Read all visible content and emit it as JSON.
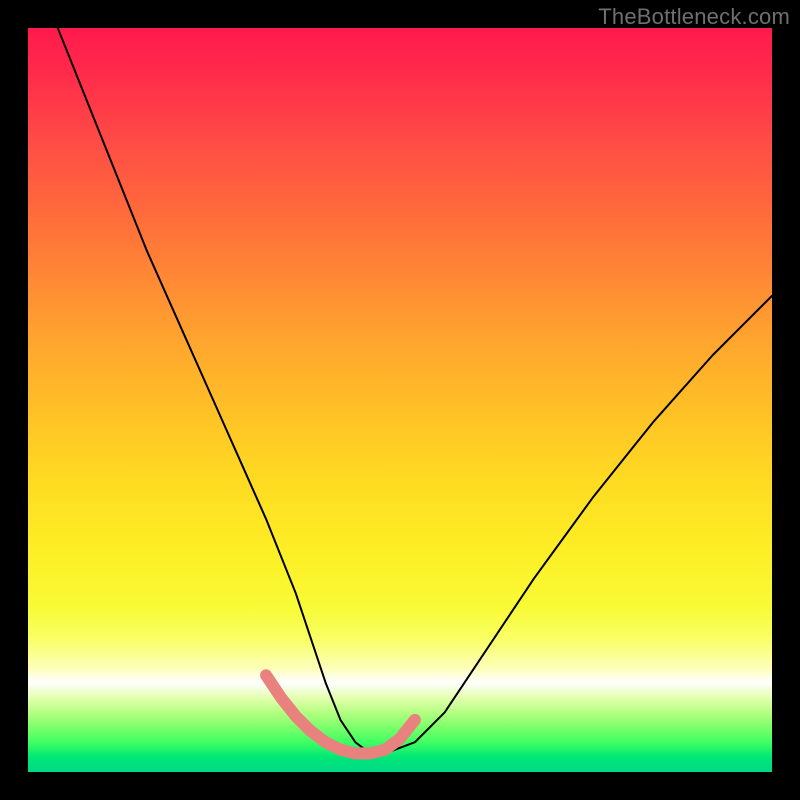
{
  "watermark": "TheBottleneck.com",
  "chart_data": {
    "type": "line",
    "title": "",
    "xlabel": "",
    "ylabel": "",
    "xlim": [
      0,
      100
    ],
    "ylim": [
      0,
      100
    ],
    "grid": false,
    "legend": false,
    "series": [
      {
        "name": "bottleneck-curve",
        "color": "#000000",
        "stroke_width": 2,
        "x": [
          4,
          8,
          12,
          16,
          20,
          24,
          28,
          32,
          36,
          38,
          40,
          42,
          44,
          46,
          48,
          52,
          56,
          60,
          64,
          68,
          72,
          76,
          80,
          84,
          88,
          92,
          96,
          100
        ],
        "values": [
          100,
          90,
          80,
          70,
          61,
          52,
          43,
          34,
          24,
          18,
          12,
          7,
          4,
          2.5,
          2.5,
          4,
          8,
          14,
          20,
          26,
          31.5,
          37,
          42,
          47,
          51.5,
          56,
          60,
          64
        ]
      },
      {
        "name": "optimal-range-highlight",
        "color": "#e9827e",
        "stroke_width": 12,
        "x": [
          32,
          34,
          36,
          38,
          40,
          42,
          44,
          46,
          48,
          50,
          52
        ],
        "values": [
          13,
          10,
          7.5,
          5.5,
          4,
          3,
          2.5,
          2.5,
          3,
          4.5,
          7
        ]
      }
    ],
    "background_gradient": {
      "direction": "top-to-bottom",
      "stops": [
        {
          "pos": 0.0,
          "color": "#ff1a4d"
        },
        {
          "pos": 0.15,
          "color": "#ff4b46"
        },
        {
          "pos": 0.34,
          "color": "#ff8a34"
        },
        {
          "pos": 0.52,
          "color": "#ffc226"
        },
        {
          "pos": 0.7,
          "color": "#fdee25"
        },
        {
          "pos": 0.82,
          "color": "#f9ff63"
        },
        {
          "pos": 0.88,
          "color": "#ffffff"
        },
        {
          "pos": 0.94,
          "color": "#7cff6a"
        },
        {
          "pos": 1.0,
          "color": "#00d884"
        }
      ]
    }
  }
}
